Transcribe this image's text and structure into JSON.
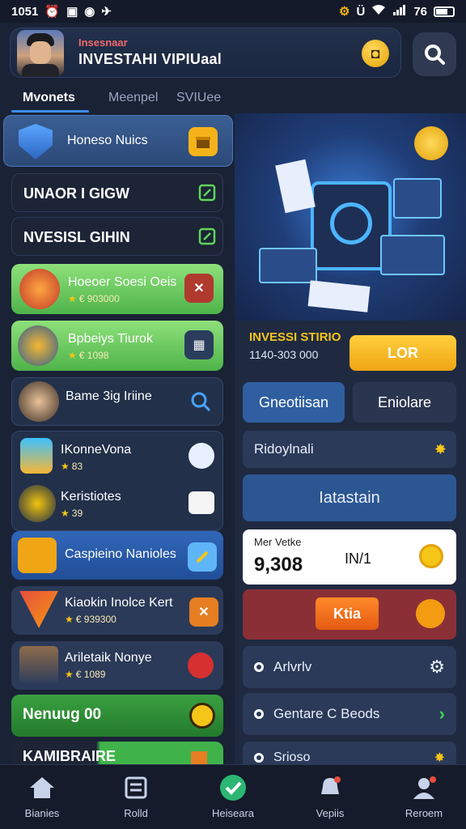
{
  "status_bar": {
    "time": "1051",
    "signal": "76"
  },
  "header": {
    "subtitle": "Insesnaar",
    "title": "INVESTAHI VIPIUaal",
    "coin_icon": "coin-icon"
  },
  "tabs": [
    {
      "label": "Mvonets",
      "active": true
    },
    {
      "label": "Meenpel",
      "active": false
    },
    {
      "label": "SVIUee",
      "active": false
    }
  ],
  "left_cards": {
    "featured": {
      "label": "Honeso Nuics"
    },
    "dark1": {
      "label": "UNAOR I GIGW"
    },
    "dark2": {
      "label": "NVESISL GIHIN"
    },
    "green1": {
      "label": "Hoeoer Soesi Oeis",
      "sub": "€ 903000"
    },
    "green2": {
      "label": "Bpbeiys Tiurok",
      "sub": "€ 1098"
    },
    "game": {
      "label": "Bame 3ig Iriine"
    },
    "item1": {
      "label": "IKonneVona",
      "sub": "83"
    },
    "item2": {
      "label": "Keristiotes",
      "sub": "39"
    },
    "blue": {
      "label": "Caspieino Nanioles"
    },
    "slate1": {
      "label": "Kiaokin Inolce Kert",
      "sub": "€ 939300"
    },
    "slate2": {
      "label": "Ariletaik Nonye",
      "sub": "€ 1089"
    },
    "green3": {
      "label": "Nenuug 00"
    },
    "cut": {
      "label": "KAMIBRAIRE"
    }
  },
  "right_panel": {
    "invest_title": "INVESSI STIRIO",
    "invest_amount": "1140-303 000",
    "lor_button": "LOR",
    "btn_left": "Gneotiisan",
    "btn_right": "Eniolare",
    "ridoy": "Ridoylnali",
    "iatastain": "Iatastain",
    "stat_label": "Mer Vetke",
    "stat_value": "9,308",
    "stat_mid": "IN/1",
    "kita_button": "Ktia",
    "arivliv": "Arlvrlv",
    "gentare": "Gentare C Beods",
    "partial": "Srioso"
  },
  "bottom_nav": [
    {
      "label": "Bianies",
      "icon": "home-icon"
    },
    {
      "label": "Rolld",
      "icon": "list-icon"
    },
    {
      "label": "Heiseara",
      "icon": "check-icon"
    },
    {
      "label": "Vepiis",
      "icon": "bell-icon"
    },
    {
      "label": "Reroem",
      "icon": "user-icon"
    }
  ],
  "colors": {
    "accent": "#3c8cf0",
    "gold": "#f5c518",
    "bg": "#1a2236"
  }
}
